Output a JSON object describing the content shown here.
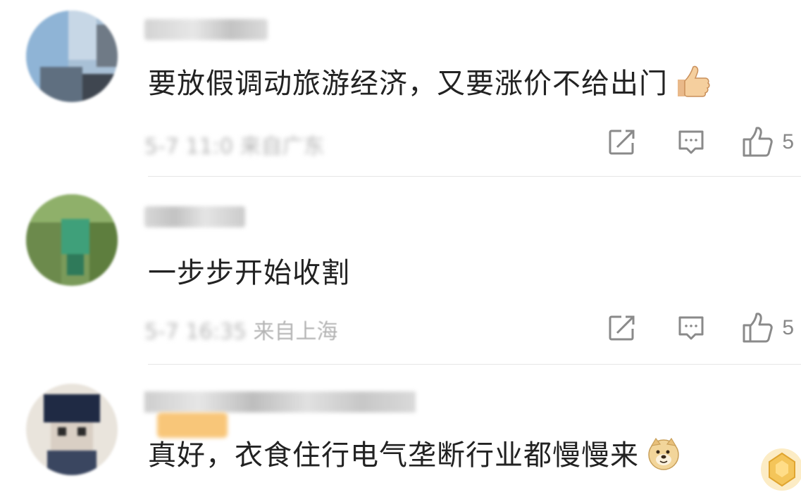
{
  "comments": [
    {
      "username": "",
      "text": "要放假调动旅游经济，又要涨价不给出门",
      "emoji_icon": "thumbs-up-emoji",
      "meta_time": "5-7 11:0",
      "meta_location": "来自广东",
      "like_count": "5"
    },
    {
      "username": "",
      "text": "一步步开始收割",
      "meta_time": "5-7 16:35",
      "meta_location": "来自上海",
      "like_count": "5"
    },
    {
      "username": "",
      "text": "真好，衣食住行电气垄断行业都慢慢来",
      "emoji_icon": "doge-emoji",
      "meta_time": "",
      "meta_location": "",
      "like_count": ""
    }
  ],
  "icons": {
    "repost": "share-out-icon",
    "reply": "comment-bubble-icon",
    "like": "thumbs-up-outline-icon"
  },
  "colors": {
    "text": "#222222",
    "meta": "#b5b5b5",
    "icon": "#8a8a8a",
    "divider": "#e6e6e6",
    "badge": "#f8c06b"
  }
}
